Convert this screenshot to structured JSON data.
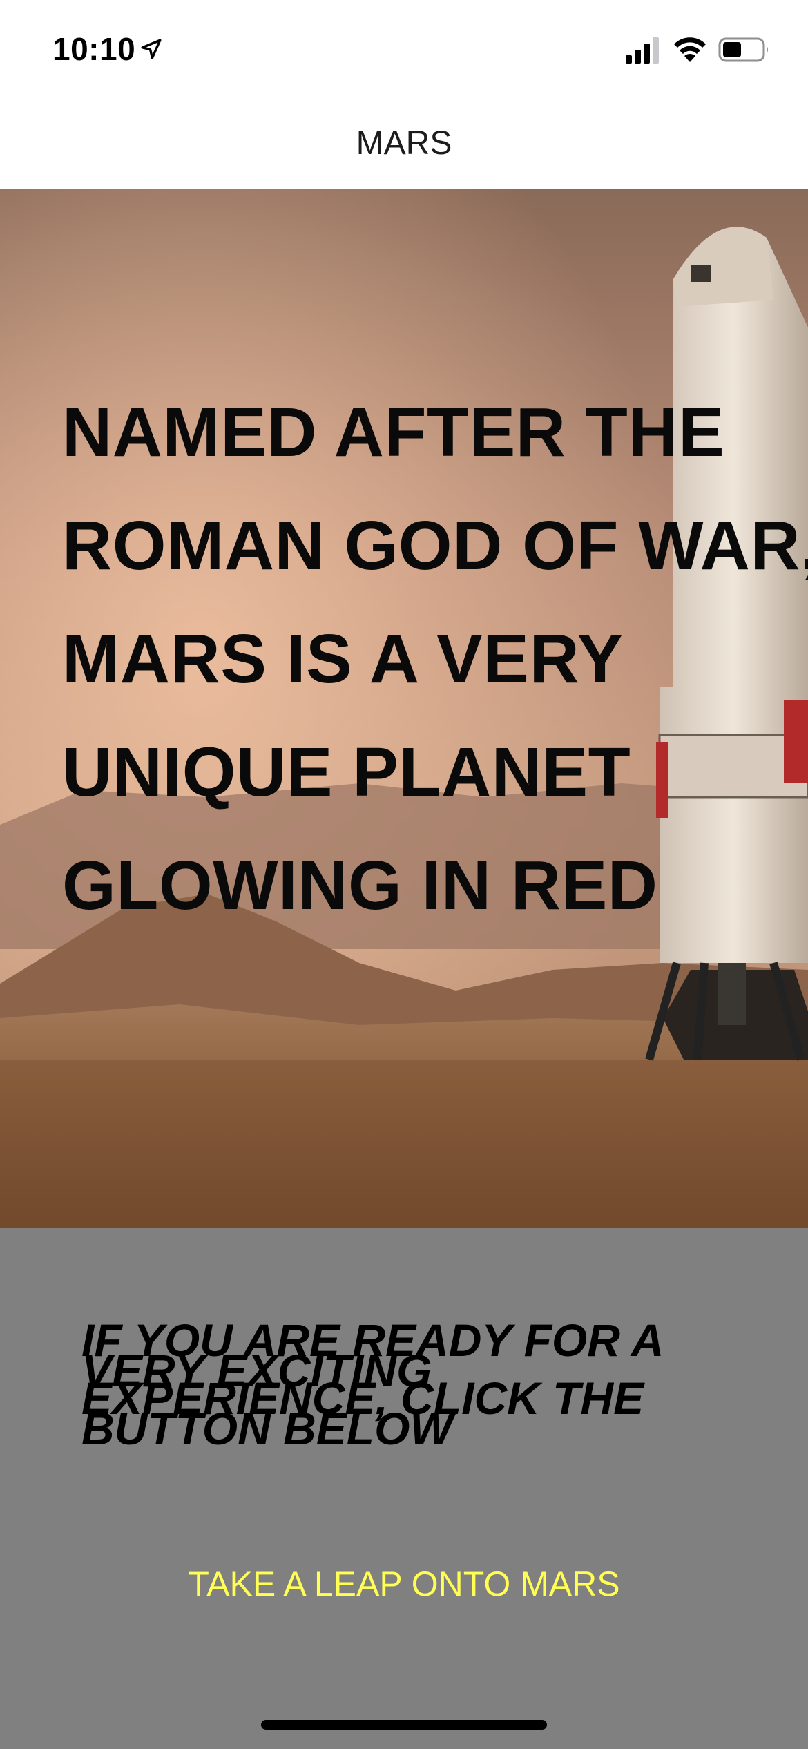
{
  "status_bar": {
    "time": "10:10"
  },
  "nav": {
    "title": "MARS"
  },
  "hero": {
    "headline": "NAMED AFTER THE\nROMAN GOD OF WAR,\nMARS IS A VERY\nUNIQUE PLANET\nGLOWING IN RED"
  },
  "panel": {
    "text_a": "IF YOU ARE READY FOR A\nEXPERIENCE, CLICK THE",
    "text_b": "VERY EXCITING\nBUTTON BELOW",
    "button_label": "TAKE A LEAP ONTO MARS"
  },
  "colors": {
    "panel_bg": "#808080",
    "button_text": "#ffff54"
  }
}
